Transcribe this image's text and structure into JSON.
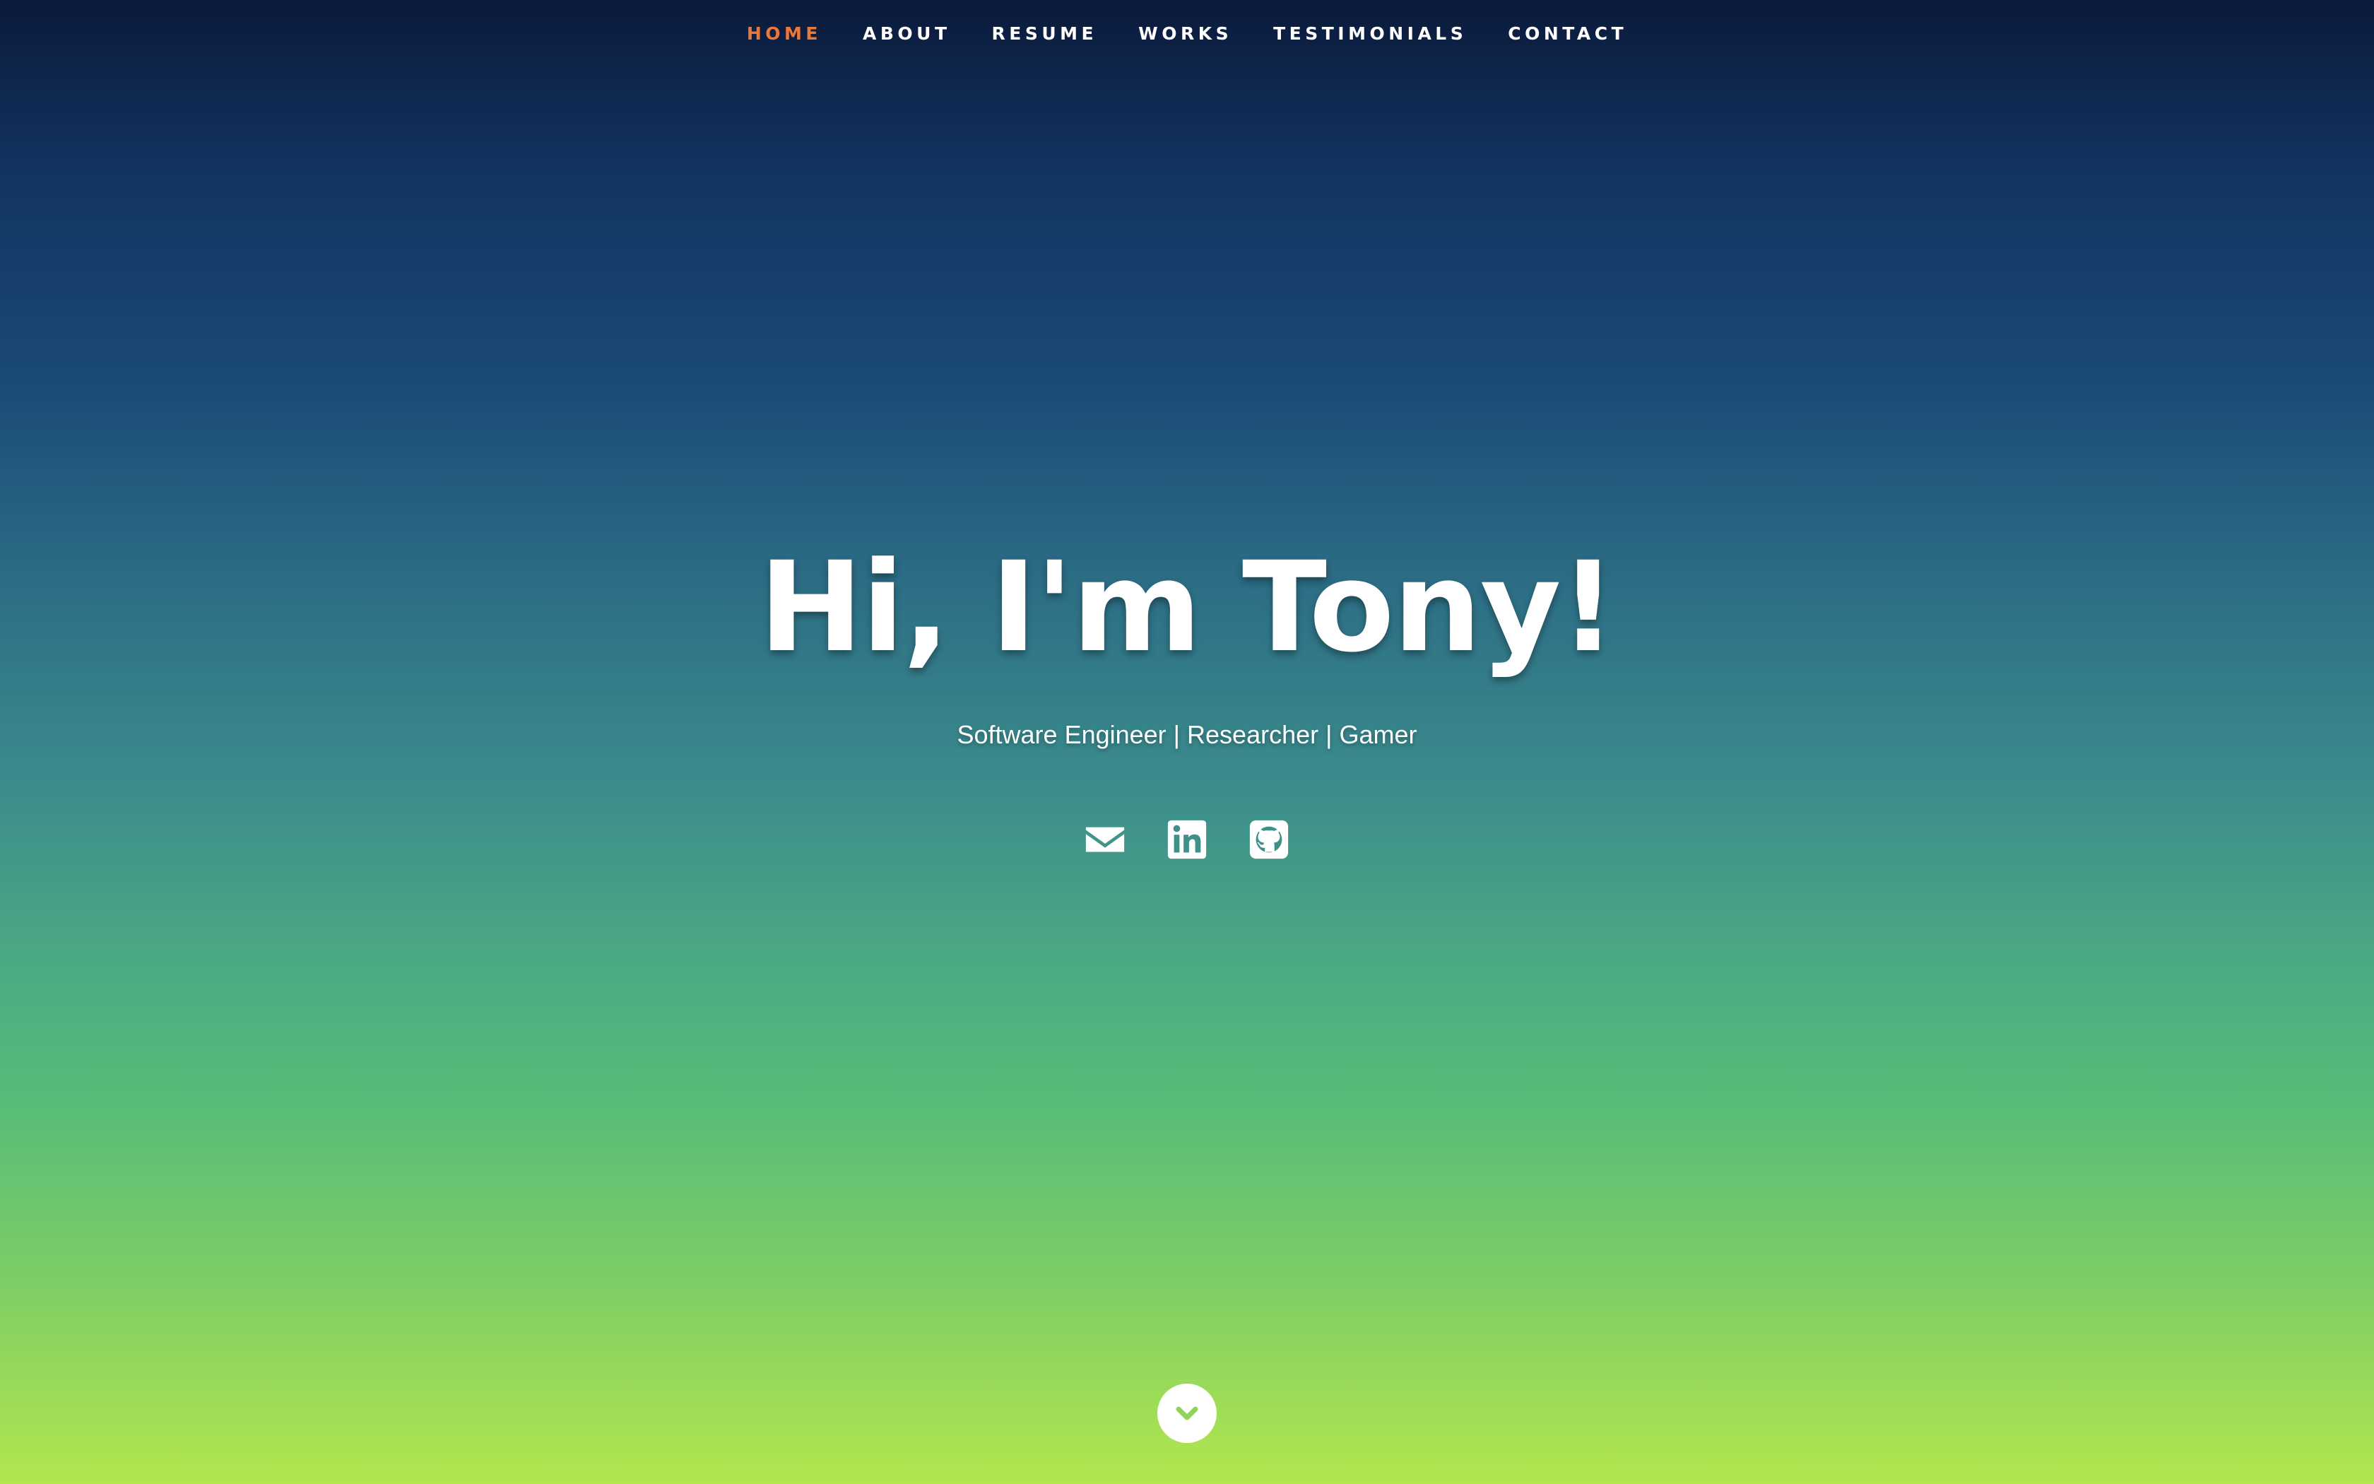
{
  "nav": {
    "items": [
      {
        "label": "HOME",
        "active": true
      },
      {
        "label": "ABOUT",
        "active": false
      },
      {
        "label": "RESUME",
        "active": false
      },
      {
        "label": "WORKS",
        "active": false
      },
      {
        "label": "TESTIMONIALS",
        "active": false
      },
      {
        "label": "CONTACT",
        "active": false
      }
    ]
  },
  "hero": {
    "title": "Hi, I'm Tony!",
    "subtitle": "Software Engineer | Researcher | Gamer"
  },
  "socials": [
    {
      "icon": "envelope-icon"
    },
    {
      "icon": "linkedin-icon"
    },
    {
      "icon": "github-icon"
    }
  ],
  "scroll": {
    "icon": "chevron-down-icon"
  },
  "colors": {
    "accent": "#e8793a",
    "text": "#ffffff",
    "gradient_top": "#0b1a3b",
    "gradient_bottom": "#b3e64d",
    "scroll_chevron": "#8fd45a"
  }
}
